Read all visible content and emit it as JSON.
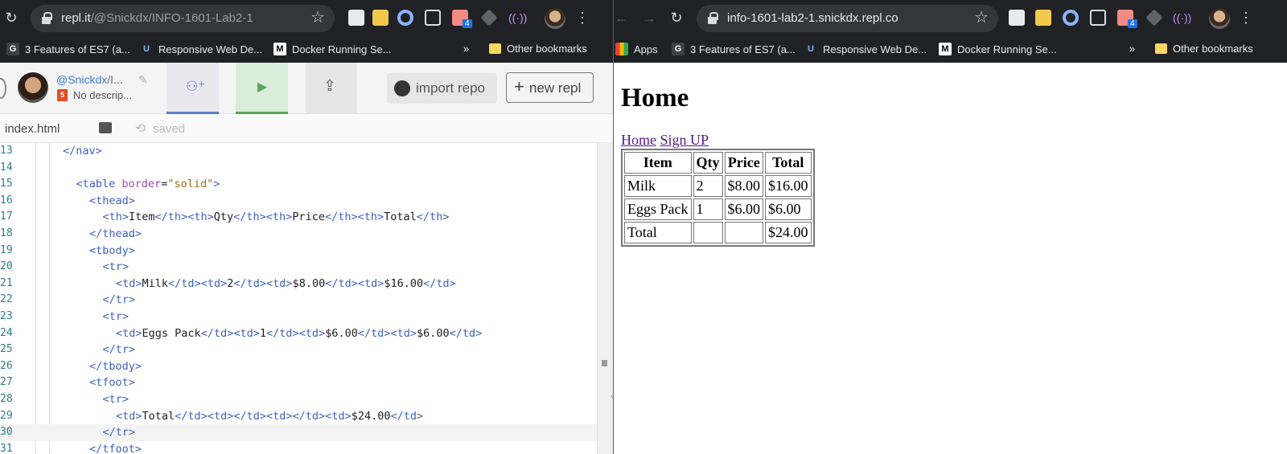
{
  "left_browser": {
    "url_host": "repl.it",
    "url_path": "/@Snickdx/INFO-1601-Lab2-1",
    "bookmarks": [
      {
        "label": "3 Features of ES7 (a...",
        "icon": "G"
      },
      {
        "label": "Responsive Web De...",
        "icon": "U"
      },
      {
        "label": "Docker Running Se...",
        "icon": "M"
      }
    ],
    "more": "»",
    "other_bookmarks": "Other bookmarks",
    "ext_badge": "4"
  },
  "right_browser": {
    "url": "info-1601-lab2-1.snickdx.repl.co",
    "apps_label": "Apps",
    "bookmarks": [
      {
        "label": "3 Features of ES7 (a...",
        "icon": "G"
      },
      {
        "label": "Responsive Web De...",
        "icon": "U"
      },
      {
        "label": "Docker Running Se...",
        "icon": "M"
      }
    ],
    "more": "»",
    "other_bookmarks": "Other bookmarks",
    "ext_badge": "4"
  },
  "replit": {
    "user": "@Snickdx",
    "repl_name_short": "/I...",
    "description": "No descrip...",
    "import_label": "import repo",
    "new_label": "new repl",
    "file_tab": "index.html",
    "saved_label": "saved"
  },
  "editor": {
    "lines": [
      {
        "n": "13",
        "indent": 0,
        "html": "</nav>"
      },
      {
        "n": "14",
        "indent": 0,
        "html": ""
      },
      {
        "n": "15",
        "indent": 1,
        "html": "<table border=\"solid\">"
      },
      {
        "n": "16",
        "indent": 2,
        "html": "<thead>"
      },
      {
        "n": "17",
        "indent": 3,
        "html": "<th>Item</th><th>Qty</th><th>Price</th><th>Total</th>"
      },
      {
        "n": "18",
        "indent": 2,
        "html": "</thead>"
      },
      {
        "n": "19",
        "indent": 2,
        "html": "<tbody>"
      },
      {
        "n": "20",
        "indent": 3,
        "html": "<tr>"
      },
      {
        "n": "21",
        "indent": 4,
        "html": "<td>Milk</td><td>2</td><td>$8.00</td><td>$16.00</td>"
      },
      {
        "n": "22",
        "indent": 3,
        "html": "</tr>"
      },
      {
        "n": "23",
        "indent": 3,
        "html": "<tr>"
      },
      {
        "n": "24",
        "indent": 4,
        "html": "<td>Eggs Pack</td><td>1</td><td>$6.00</td><td>$6.00</td>"
      },
      {
        "n": "25",
        "indent": 3,
        "html": "</tr>"
      },
      {
        "n": "26",
        "indent": 2,
        "html": "</tbody>"
      },
      {
        "n": "27",
        "indent": 2,
        "html": "<tfoot>"
      },
      {
        "n": "28",
        "indent": 3,
        "html": "<tr>"
      },
      {
        "n": "29",
        "indent": 4,
        "html": "<td>Total</td><td></td><td></td><td>$24.00</td>"
      },
      {
        "n": "30",
        "indent": 3,
        "html": "</tr>"
      },
      {
        "n": "31",
        "indent": 2,
        "html": "</tfoot>"
      }
    ]
  },
  "preview": {
    "heading": "Home",
    "links": [
      "Home",
      "Sign UP"
    ],
    "headers": [
      "Item",
      "Qty",
      "Price",
      "Total"
    ],
    "rows": [
      [
        "Milk",
        "2",
        "$8.00",
        "$16.00"
      ],
      [
        "Eggs Pack",
        "1",
        "$6.00",
        "$6.00"
      ],
      [
        "Total",
        "",
        "",
        "$24.00"
      ]
    ]
  }
}
